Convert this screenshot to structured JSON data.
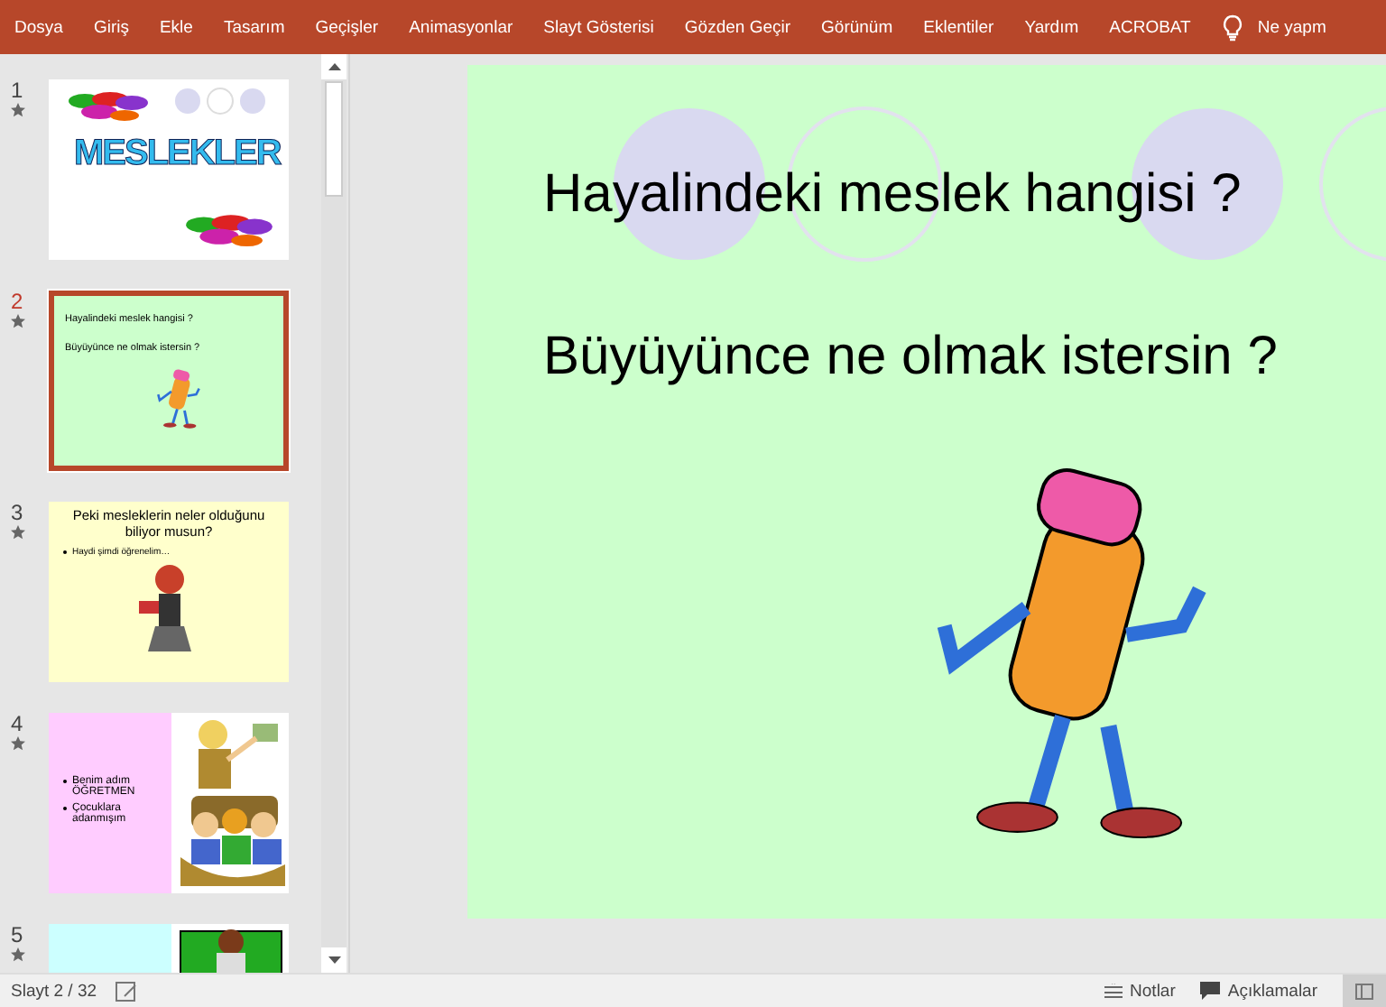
{
  "ribbon": {
    "tabs": [
      {
        "label": "Dosya",
        "selected": false
      },
      {
        "label": "Giriş",
        "selected": false
      },
      {
        "label": "Ekle",
        "selected": false
      },
      {
        "label": "Tasarım",
        "selected": false
      },
      {
        "label": "Geçişler",
        "selected": false
      },
      {
        "label": "Animasyonlar",
        "selected": false
      },
      {
        "label": "Slayt Gösterisi",
        "selected": false
      },
      {
        "label": "Gözden Geçir",
        "selected": false
      },
      {
        "label": "Görünüm",
        "selected": false
      },
      {
        "label": "Eklentiler",
        "selected": false
      },
      {
        "label": "Yardım",
        "selected": false
      },
      {
        "label": "ACROBAT",
        "selected": false
      }
    ],
    "tell_me": "Ne yapm"
  },
  "slides": [
    {
      "number": "1",
      "selected": false,
      "kind": "wordart",
      "color": "#ffffff",
      "title": "MESLEKLER"
    },
    {
      "number": "2",
      "selected": true,
      "kind": "circles",
      "color": "#ccffcc",
      "lines": [
        "Hayalindeki meslek hangisi ?",
        "Büyüyünce ne olmak  istersin ?"
      ]
    },
    {
      "number": "3",
      "selected": false,
      "kind": "title-bullets",
      "color": "#ffffcc",
      "title": "Peki mesleklerin neler olduğunu biliyor musun?",
      "bullets": [
        "Haydi şimdi öğrenelim…"
      ]
    },
    {
      "number": "4",
      "selected": false,
      "kind": "split",
      "color": "#ffccff",
      "bullets": [
        "Benim adım ÖĞRETMEN",
        "Çocuklara adanmışım"
      ]
    },
    {
      "number": "5",
      "selected": false,
      "kind": "split",
      "color": "#ccffff"
    }
  ],
  "main_slide": {
    "lines": [
      "Hayalindeki meslek hangisi ?",
      "Büyüyünce ne olmak  istersin ?"
    ]
  },
  "status_bar": {
    "slide_counter": "Slayt 2 / 32",
    "notes": "Notlar",
    "comments": "Açıklamalar"
  }
}
